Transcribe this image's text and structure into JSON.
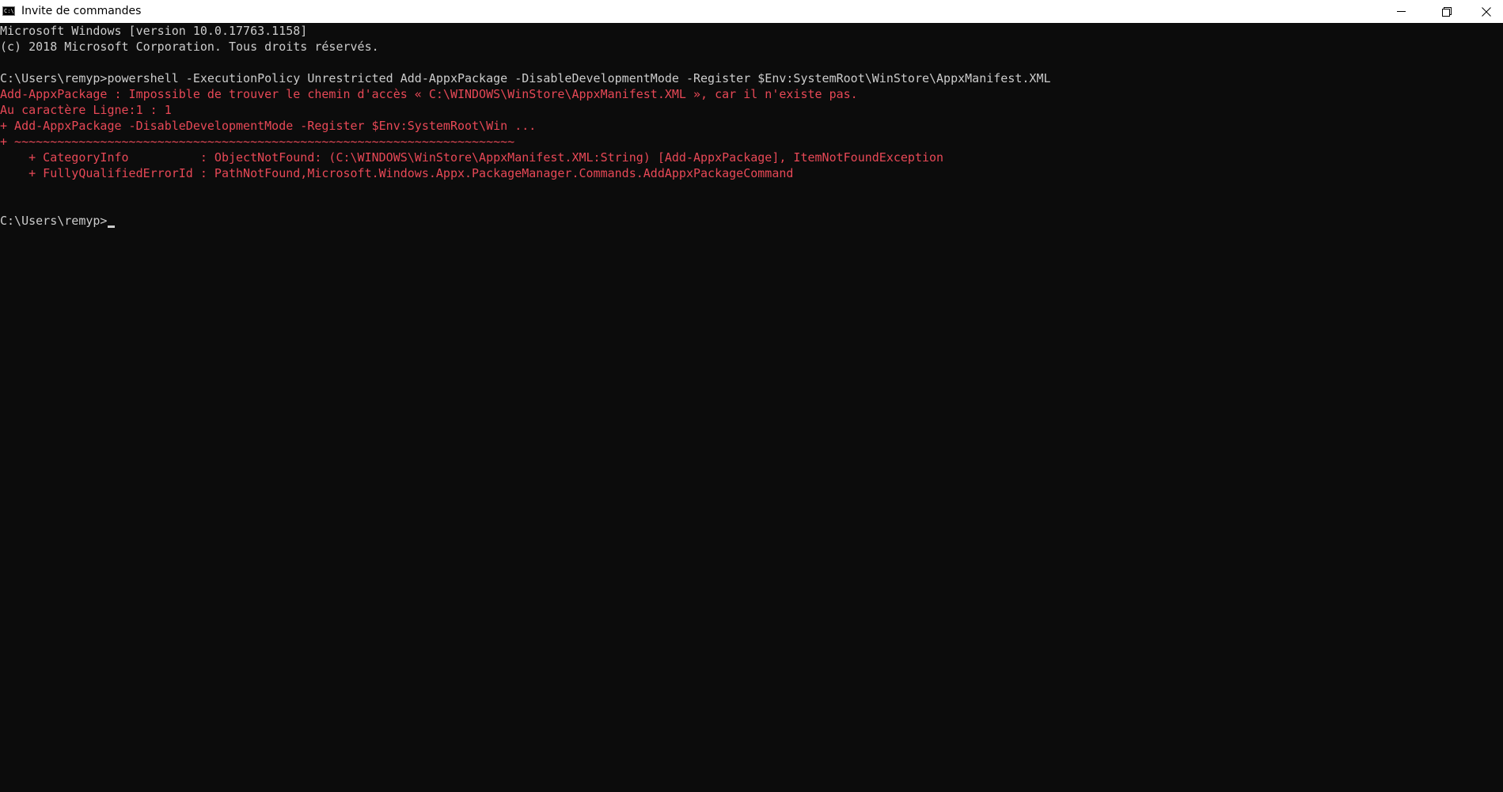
{
  "window": {
    "title": "Invite de commandes",
    "icon": "cmd-icon",
    "icon_text": "C:\\",
    "controls": {
      "minimize": "minimize-icon",
      "restore": "restore-icon",
      "close": "close-icon"
    }
  },
  "colors": {
    "background": "#0c0c0c",
    "text": "#cccccc",
    "error": "#e74856",
    "titlebar": "#ffffff"
  },
  "console": {
    "lines": [
      "Microsoft Windows [version 10.0.17763.1158]",
      "(c) 2018 Microsoft Corporation. Tous droits réservés.",
      "C:\\Users\\remyp>powershell -ExecutionPolicy Unrestricted Add-AppxPackage -DisableDevelopmentMode -Register $Env:SystemRoot\\WinStore\\AppxManifest.XML",
      "Add-AppxPackage : Impossible de trouver le chemin d'accès « C:\\WINDOWS\\WinStore\\AppxManifest.XML », car il n'existe pas.",
      "Au caractère Ligne:1 : 1",
      "+ Add-AppxPackage -DisableDevelopmentMode -Register $Env:SystemRoot\\Win ...",
      "+ ~~~~~~~~~~~~~~~~~~~~~~~~~~~~~~~~~~~~~~~~~~~~~~~~~~~~~~~~~~~~~~~~~~~~~~",
      "    + CategoryInfo          : ObjectNotFound: (C:\\WINDOWS\\WinStore\\AppxManifest.XML:String) [Add-AppxPackage], ItemNotFoundException",
      "    + FullyQualifiedErrorId : PathNotFound,Microsoft.Windows.Appx.PackageManager.Commands.AddAppxPackageCommand"
    ],
    "prompt": "C:\\Users\\remyp>"
  }
}
